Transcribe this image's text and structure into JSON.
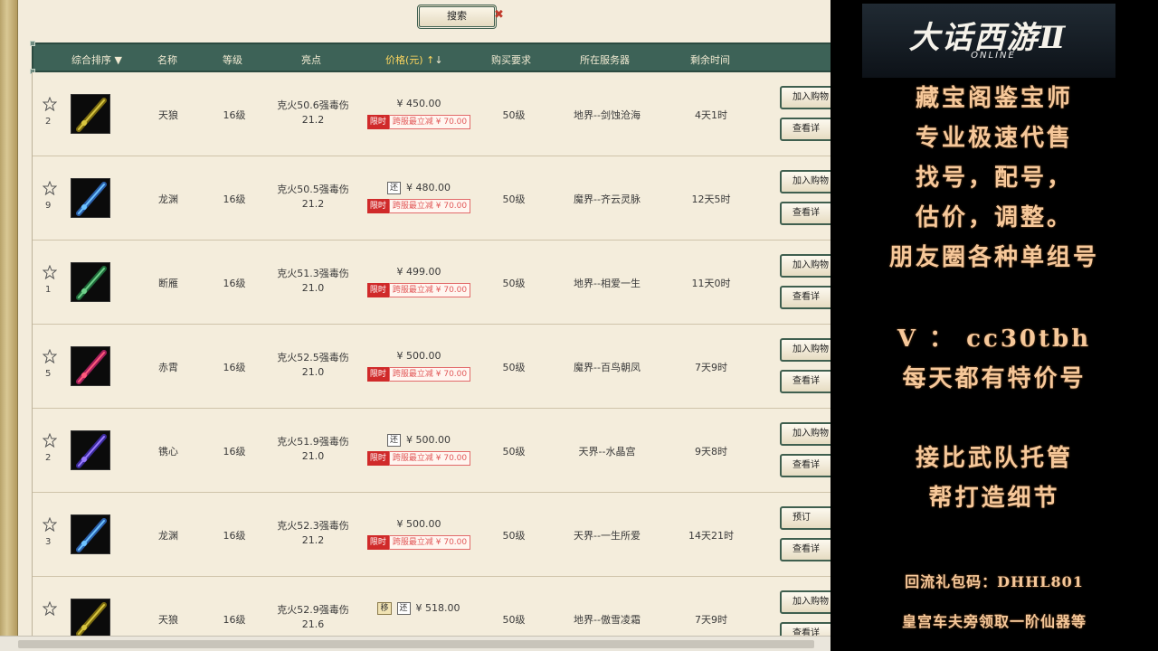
{
  "search": {
    "label": "搜索",
    "close": "✖"
  },
  "columns": {
    "sort": "综合排序",
    "name": "名称",
    "level": "等级",
    "highlight": "亮点",
    "price": "价格(元)",
    "requirement": "购买要求",
    "server": "所在服务器",
    "time_left": "剩余时间"
  },
  "common": {
    "limit_tag": "限时",
    "promo_text": "跨服最立减 ¥ 70.00",
    "cart_button": "加入购物",
    "detail_button": "查看详",
    "reserve_button": "预订",
    "return_tag": "还",
    "move_tag": "移"
  },
  "rows": [
    {
      "rank": "2",
      "name": "天狼",
      "level": "16级",
      "hl1": "克火50.6强毒伤",
      "hl2": "21.2",
      "price": "¥ 450.00",
      "req": "50级",
      "server": "地界--剑蚀沧海",
      "time": "4天1时",
      "icon": "sword-yellow",
      "btn1": "cart"
    },
    {
      "rank": "9",
      "name": "龙渊",
      "level": "16级",
      "hl1": "克火50.5强毒伤",
      "hl2": "21.2",
      "price": "¥ 480.00",
      "req": "50级",
      "server": "魔界--齐云灵脉",
      "time": "12天5时",
      "icon": "sword-blue",
      "btn1": "cart"
    },
    {
      "rank": "1",
      "name": "断雁",
      "level": "16级",
      "hl1": "克火51.3强毒伤",
      "hl2": "21.0",
      "price": "¥ 499.00",
      "req": "50级",
      "server": "地界--相爱一生",
      "time": "11天0时",
      "icon": "sword-green",
      "btn1": "cart"
    },
    {
      "rank": "5",
      "name": "赤霄",
      "level": "16级",
      "hl1": "克火52.5强毒伤",
      "hl2": "21.0",
      "price": "¥ 500.00",
      "req": "50级",
      "server": "魔界--百鸟朝凤",
      "time": "7天9时",
      "icon": "sword-red",
      "btn1": "cart"
    },
    {
      "rank": "2",
      "name": "镌心",
      "level": "16级",
      "hl1": "克火51.9强毒伤",
      "hl2": "21.0",
      "price": "¥ 500.00",
      "req": "50级",
      "server": "天界--水晶宫",
      "time": "9天8时",
      "icon": "sword-purple",
      "btn1": "cart"
    },
    {
      "rank": "3",
      "name": "龙渊",
      "level": "16级",
      "hl1": "克火52.3强毒伤",
      "hl2": "21.2",
      "price": "¥ 500.00",
      "req": "50级",
      "server": "天界--一生所爱",
      "time": "14天21时",
      "icon": "sword-blue",
      "btn1": "reserve"
    },
    {
      "rank": "",
      "name": "天狼",
      "level": "16级",
      "hl1": "克火52.9强毒伤",
      "hl2": "21.6",
      "price": "¥ 518.00",
      "req": "50级",
      "server": "地界--傲雪凌霜",
      "time": "7天9时",
      "icon": "sword-yellow",
      "btn1": "cart"
    }
  ],
  "promo": {
    "logo": "大话西游Ⅱ",
    "logo_sub": "ONLINE",
    "lines": [
      "藏宝阁鉴宝师",
      "专业极速代售",
      "找号，配号，",
      "估价，调整。",
      "朋友圈各种单组号",
      "V ： cc30tbh",
      "每天都有特价号",
      "接比武队托管",
      "帮打造细节"
    ],
    "gift_code": "回流礼包码：DHHL801",
    "gift_note": "皇宫车夫旁领取一阶仙器等"
  }
}
